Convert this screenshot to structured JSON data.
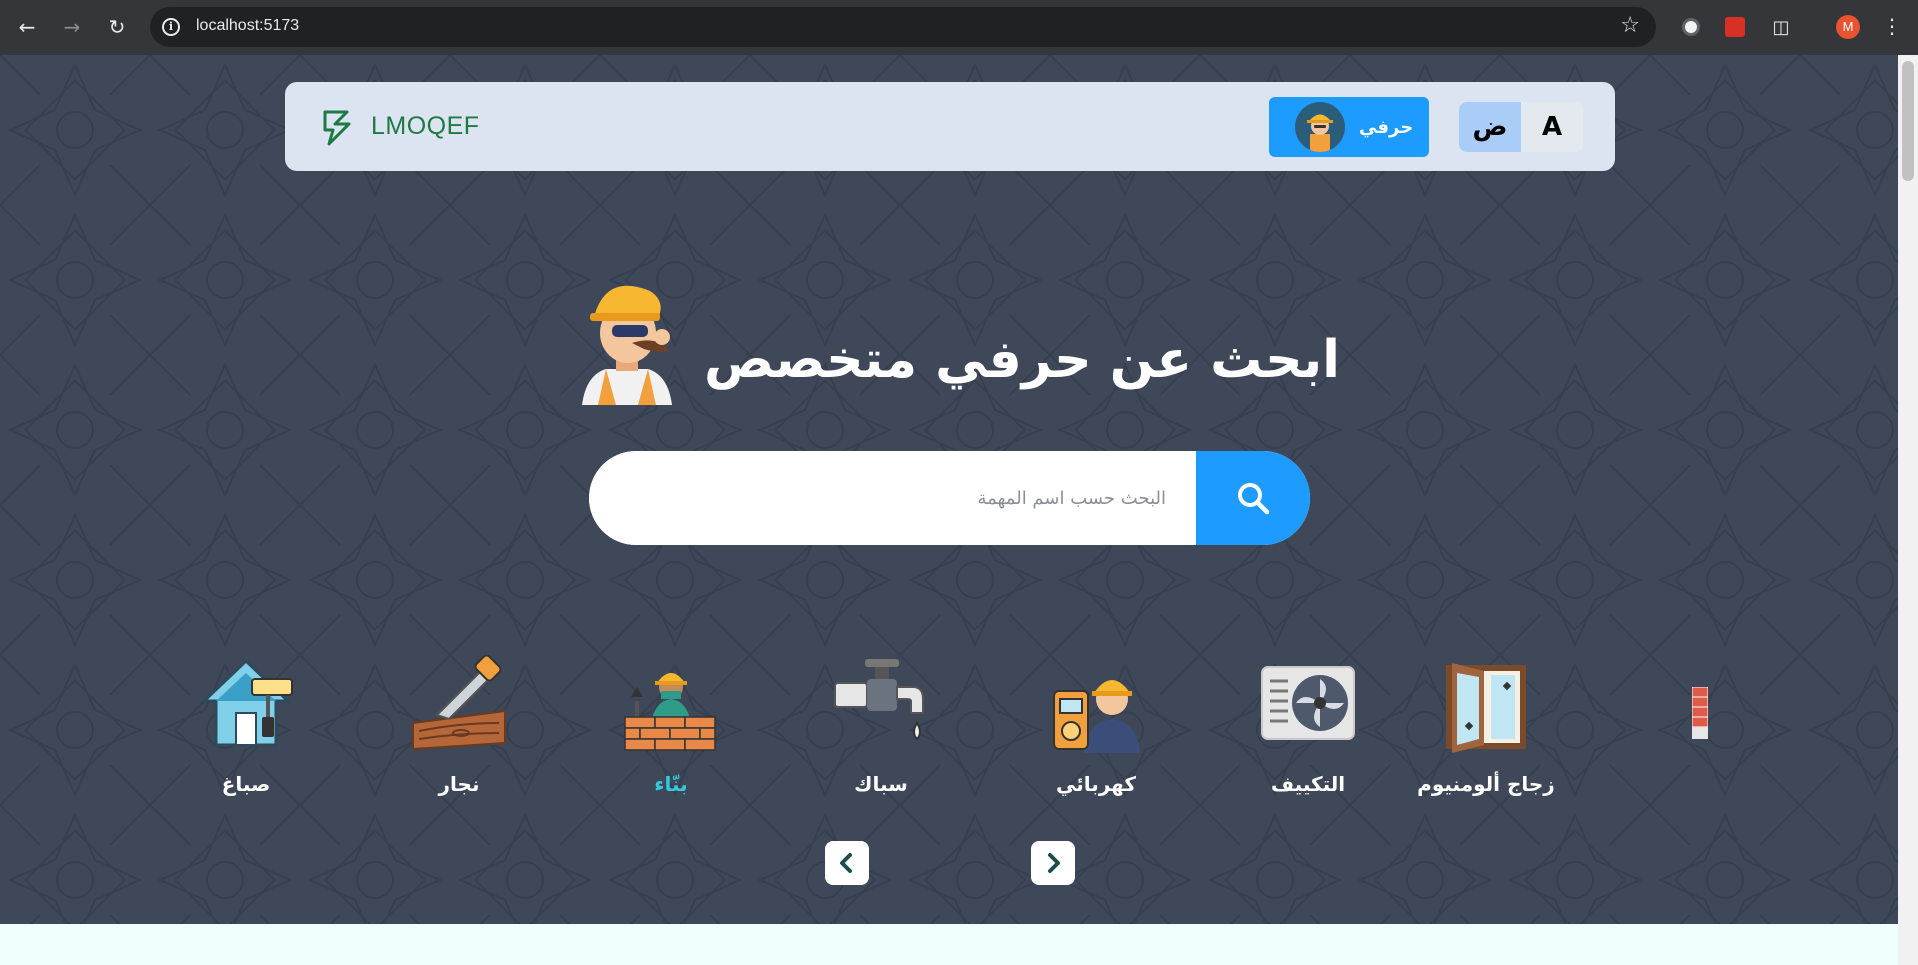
{
  "browser": {
    "url": "localhost:5173",
    "profile_initial": "M"
  },
  "navbar": {
    "logo_text": "LMOQEF",
    "craftsman_label": "حرفي",
    "lang_options": [
      "A",
      "ض"
    ],
    "active_lang": "ض"
  },
  "hero": {
    "title": "ابحث عن حرفي متخصص",
    "search_placeholder": "البحث حسب اسم المهمة"
  },
  "categories": [
    {
      "label": "زجاج ألومنيوم",
      "icon": "glass-window-icon",
      "active": false
    },
    {
      "label": "التكييف",
      "icon": "air-conditioner-icon",
      "active": false
    },
    {
      "label": "كهربائي",
      "icon": "electrician-icon",
      "active": false
    },
    {
      "label": "سباك",
      "icon": "faucet-icon",
      "active": false
    },
    {
      "label": "بنّاء",
      "icon": "mason-icon",
      "active": true
    },
    {
      "label": "نجار",
      "icon": "saw-wood-icon",
      "active": false
    },
    {
      "label": "صباغ",
      "icon": "paint-house-icon",
      "active": false
    }
  ],
  "colors": {
    "page_bg": "#3f4858",
    "navbar_bg": "#dce4f1",
    "accent_blue": "#1e9bff",
    "logo_green": "#1d7a43",
    "active_category": "#36c8de"
  }
}
